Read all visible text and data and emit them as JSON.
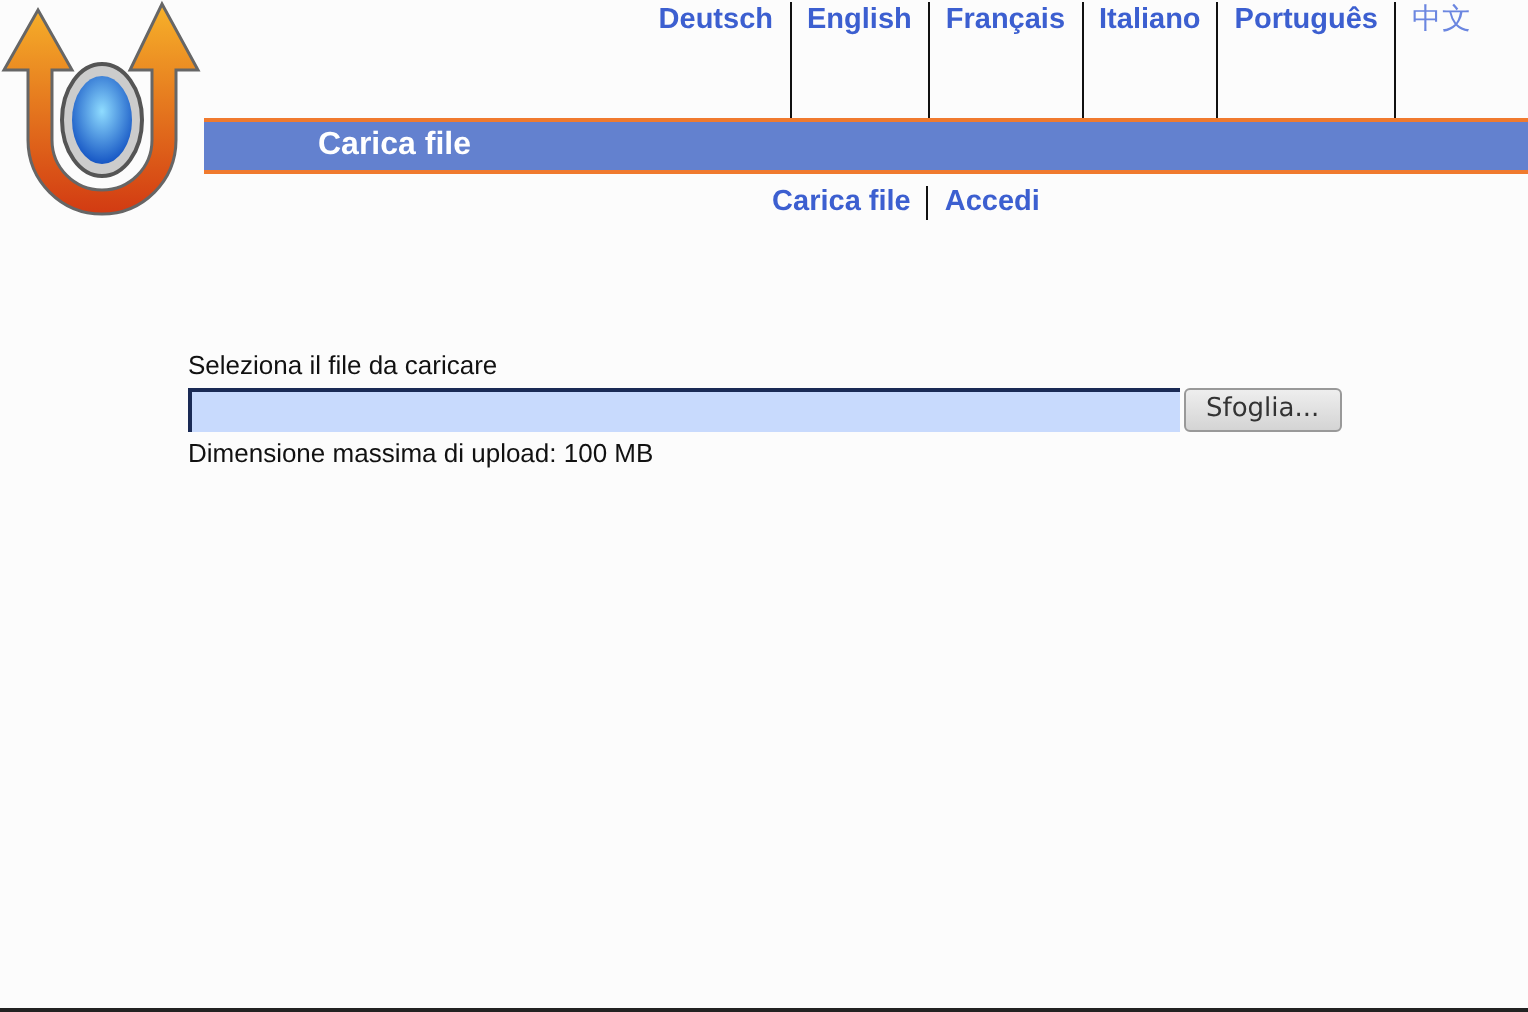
{
  "languages": [
    "Deutsch",
    "English",
    "Français",
    "Italiano",
    "Português",
    "中文"
  ],
  "header": {
    "title": "Carica file"
  },
  "nav": [
    "Carica file",
    "Accedi"
  ],
  "upload": {
    "label": "Seleziona il file da caricare",
    "button": "Sfoglia...",
    "note": "Dimensione massima di upload: 100 MB"
  }
}
